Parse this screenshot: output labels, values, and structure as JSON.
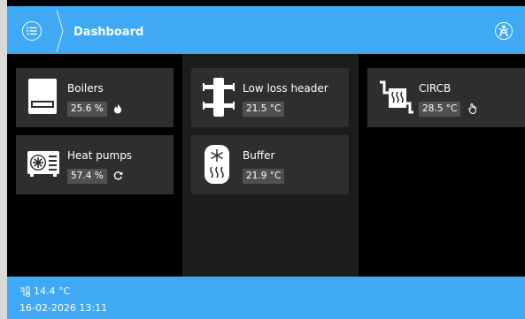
{
  "header": {
    "title": "Dashboard",
    "menu_icon": "menu-list-icon",
    "user_icon": "user-icon"
  },
  "tiles": {
    "boilers": {
      "label": "Boilers",
      "value": "25.6 %",
      "status_icon": "flame-icon"
    },
    "heat_pumps": {
      "label": "Heat pumps",
      "value": "57.4 %",
      "status_icon": "cycle-icon"
    },
    "low_loss_header": {
      "label": "Low loss header",
      "value": "21.5 °C"
    },
    "buffer": {
      "label": "Buffer",
      "value": "21.9 °C"
    },
    "circb": {
      "label": "CIRCB",
      "value": "28.5 °C",
      "status_icon": "hand-icon"
    }
  },
  "footer": {
    "outdoor_temp": "14.4 °C",
    "datetime": "16-02-2026 13:11"
  },
  "colors": {
    "accent": "#3fa9f5",
    "tile_bg": "#2e2e2e",
    "value_bg": "#505050",
    "page_bg": "#000000",
    "middle_column_bg": "#1c1c1c"
  }
}
